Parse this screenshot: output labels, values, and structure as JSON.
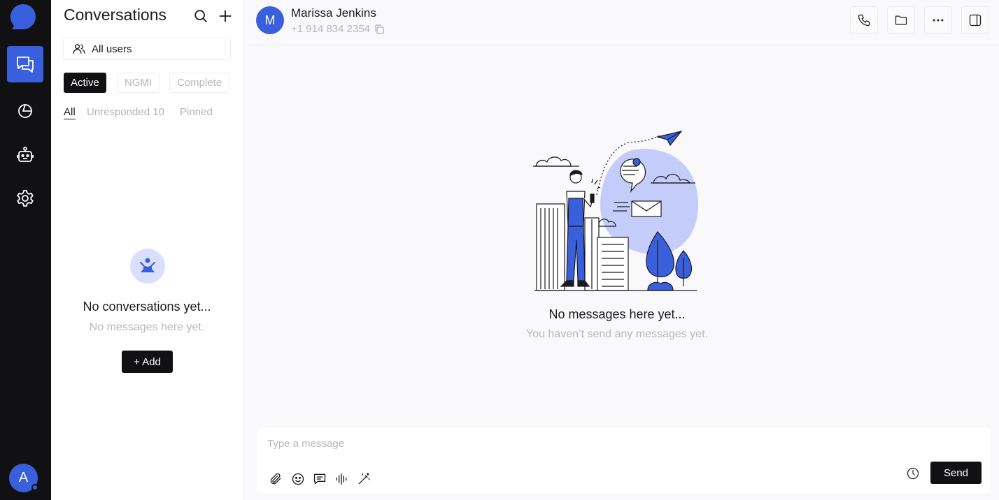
{
  "rail": {
    "items": [
      {
        "name": "chat-icon",
        "active": true
      },
      {
        "name": "analytics-icon",
        "active": false
      },
      {
        "name": "bot-icon",
        "active": false
      },
      {
        "name": "settings-icon",
        "active": false
      }
    ],
    "avatar_initial": "A"
  },
  "sidebar": {
    "title": "Conversations",
    "users_filter": "All users",
    "status_tabs": [
      "Active",
      "NGMI",
      "Complete"
    ],
    "filter_tabs": [
      "All",
      "Unresponded 10",
      "Pinned"
    ],
    "empty_title": "No conversations yet...",
    "empty_subtitle": "No messages here yet.",
    "add_label": "+ Add"
  },
  "contact": {
    "initial": "M",
    "name": "Marissa Jenkins",
    "phone": "+1 914 834 2354"
  },
  "main": {
    "empty_title": "No messages here yet...",
    "empty_subtitle": "You haven’t send any messages yet."
  },
  "composer": {
    "placeholder": "Type a message",
    "send_label": "Send"
  },
  "colors": {
    "accent": "#3a5fdc",
    "rail_bg": "#111113",
    "muted_text": "#b7b7be"
  }
}
